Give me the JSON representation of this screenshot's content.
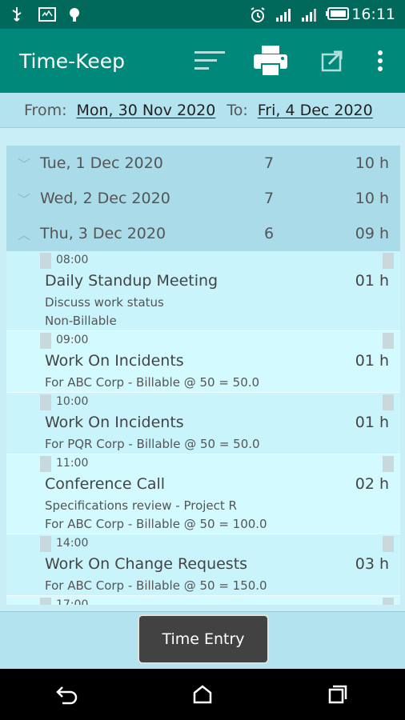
{
  "status_bar": {
    "time": "16:11",
    "icons": [
      "usb-icon",
      "debug-icon",
      "android-icon",
      "alarm-icon",
      "signal-icon",
      "signal-icon-2",
      "battery-icon"
    ]
  },
  "app_bar": {
    "title": "Time-Keep",
    "actions": [
      "sort-icon",
      "print-icon",
      "share-icon",
      "more-vert-icon"
    ]
  },
  "date_range": {
    "from_label": "From:",
    "from_value": "Mon, 30 Nov 2020",
    "to_label": "To:",
    "to_value": "Fri, 4 Dec 2020"
  },
  "groups": [
    {
      "date": "Tue, 1 Dec 2020",
      "count": "7",
      "hours": "10 h",
      "expanded": false
    },
    {
      "date": "Wed, 2 Dec 2020",
      "count": "7",
      "hours": "10 h",
      "expanded": false
    },
    {
      "date": "Thu, 3 Dec 2020",
      "count": "6",
      "hours": "09 h",
      "expanded": true
    }
  ],
  "entries": [
    {
      "time": "08:00",
      "name": "Daily Standup Meeting",
      "hours": "01 h",
      "lines": [
        "Discuss work status",
        "Non-Billable"
      ]
    },
    {
      "time": "09:00",
      "name": "Work On Incidents",
      "hours": "01 h",
      "lines": [
        "For ABC Corp - Billable @ 50 = 50.0"
      ]
    },
    {
      "time": "10:00",
      "name": "Work On Incidents",
      "hours": "01 h",
      "lines": [
        "For PQR Corp - Billable @ 50 = 50.0"
      ]
    },
    {
      "time": "11:00",
      "name": "Conference Call",
      "hours": "02 h",
      "lines": [
        "Specifications review - Project R",
        "For ABC Corp - Billable @ 50 = 100.0"
      ]
    },
    {
      "time": "14:00",
      "name": "Work On Change Requests",
      "hours": "03 h",
      "lines": [
        "For ABC Corp - Billable @ 50 = 150.0"
      ]
    },
    {
      "time": "17:00",
      "name": "",
      "hours": "",
      "lines": []
    }
  ],
  "bottom_button": {
    "label": "Time Entry"
  },
  "nav_bar": {
    "buttons": [
      "back-icon",
      "home-icon",
      "recents-icon"
    ]
  },
  "colors": {
    "primary_dark": "#00695c",
    "primary": "#00897b",
    "background": "#c9eef6"
  }
}
